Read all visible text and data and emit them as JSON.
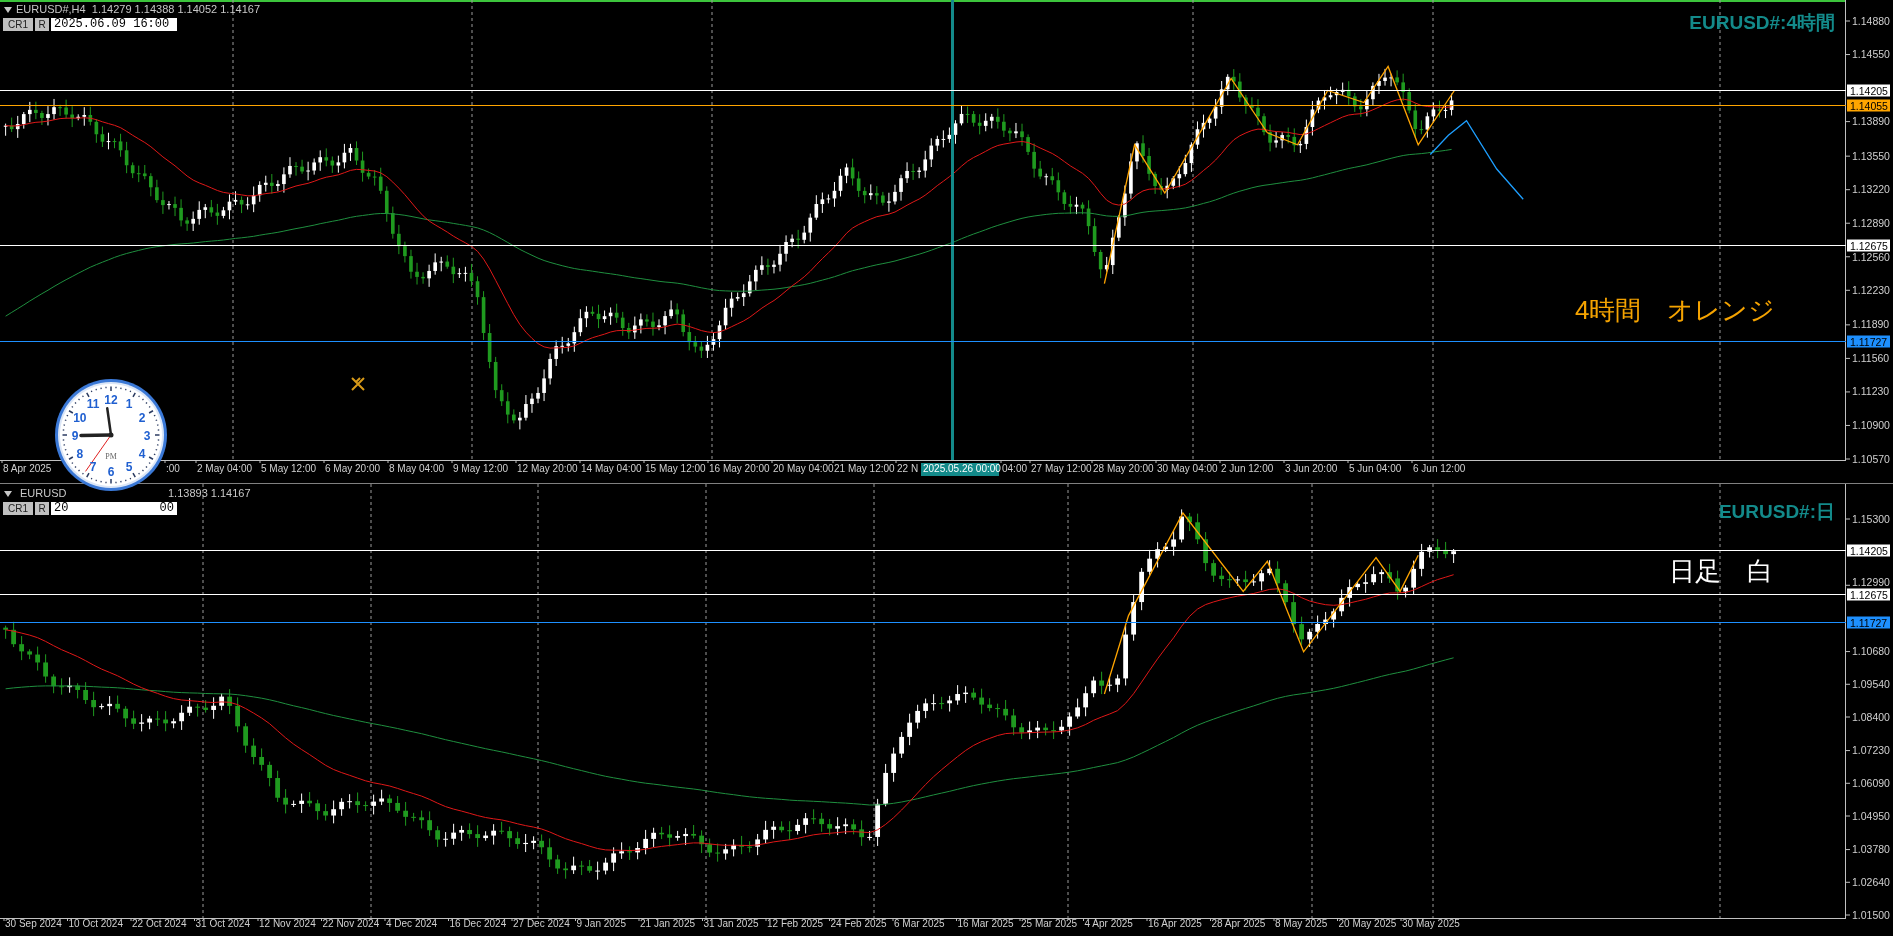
{
  "panels": [
    {
      "header": {
        "info": [
          "EURUSD#,H4  1.14279 1.14388 1.14052 1.14167"
        ],
        "buttons": [
          "CR1",
          "R"
        ],
        "date_field": [
          "2025.06.09 16:00"
        ]
      },
      "title": "EURUSD#:4時間",
      "note": {
        "text": "4時間　オレンジ",
        "color": "#f5a300"
      },
      "price_ticks": [
        "1.14880",
        "1.14550",
        "1.13890",
        "1.13550",
        "1.13220",
        "1.12890",
        "1.12560",
        "1.12230",
        "1.11890",
        "1.11560",
        "1.11230",
        "1.10900",
        "1.10570"
      ],
      "levels": [
        {
          "price": "1.14205",
          "color": "#ffffff"
        },
        {
          "price": "1.14055",
          "color": "#ffa500"
        },
        {
          "price": "1.12675",
          "color": "#ffffff"
        },
        {
          "price": "1.11727",
          "color": "#1e90ff"
        }
      ],
      "time_labels": [
        {
          "text": "8 Apr 2025",
          "kind": "label"
        },
        {
          "text": ":00",
          "kind": "label"
        },
        {
          "text": "2 May 04:00",
          "kind": "label"
        },
        {
          "text": "5 May 12:00",
          "kind": "label"
        },
        {
          "text": "6 May 20:00",
          "kind": "label"
        },
        {
          "text": "8 May 04:00",
          "kind": "label"
        },
        {
          "text": "9 May 12:00",
          "kind": "label"
        },
        {
          "text": "12 May 20:00",
          "kind": "label"
        },
        {
          "text": "14 May 04:00",
          "kind": "label"
        },
        {
          "text": "15 May 12:00",
          "kind": "label"
        },
        {
          "text": "16 May 20:00",
          "kind": "label"
        },
        {
          "text": "20 May 04:00",
          "kind": "label"
        },
        {
          "text": "21 May 12:00",
          "kind": "label"
        },
        {
          "text": "22 N",
          "kind": "label"
        },
        {
          "text": "2025.05.26 00:00",
          "kind": "cursor"
        },
        {
          "text": "04:00",
          "kind": "label"
        },
        {
          "text": "27 May 12:00",
          "kind": "label"
        },
        {
          "text": "28 May 20:00",
          "kind": "label"
        },
        {
          "text": "30 May 04:00",
          "kind": "label"
        },
        {
          "text": "2 Jun 12:00",
          "kind": "label"
        },
        {
          "text": "3 Jun 20:00",
          "kind": "label"
        },
        {
          "text": "5 Jun 04:00",
          "kind": "label"
        },
        {
          "text": "6 Jun 12:00",
          "kind": "label"
        }
      ]
    },
    {
      "header": {
        "info": [
          "EURUSD",
          "1.13893 1.14167"
        ],
        "buttons": [
          "CR1",
          "R"
        ],
        "date_field": [
          "20",
          "00"
        ]
      },
      "title": "EURUSD#:日",
      "note": {
        "text": "日足　白",
        "color": "#ffffff"
      },
      "price_ticks": [
        "1.15300",
        "1.12990",
        "1.10680",
        "1.09540",
        "1.08400",
        "1.07230",
        "1.06090",
        "1.04950",
        "1.03780",
        "1.02640",
        "1.01500"
      ],
      "levels": [
        {
          "price": "1.14205",
          "color": "#ffffff"
        },
        {
          "price": "1.12675",
          "color": "#ffffff"
        },
        {
          "price": "1.11727",
          "color": "#1e90ff"
        }
      ],
      "time_labels": [
        {
          "text": "30 Sep 2024",
          "kind": "label"
        },
        {
          "text": "10 Oct 2024",
          "kind": "label"
        },
        {
          "text": "22 Oct 2024",
          "kind": "label"
        },
        {
          "text": "31 Oct 2024",
          "kind": "label"
        },
        {
          "text": "12 Nov 2024",
          "kind": "label"
        },
        {
          "text": "22 Nov 2024",
          "kind": "label"
        },
        {
          "text": "4 Dec 2024",
          "kind": "label"
        },
        {
          "text": "16 Dec 2024",
          "kind": "label"
        },
        {
          "text": "27 Dec 2024",
          "kind": "label"
        },
        {
          "text": "9 Jan 2025",
          "kind": "label"
        },
        {
          "text": "21 Jan 2025",
          "kind": "label"
        },
        {
          "text": "31 Jan 2025",
          "kind": "label"
        },
        {
          "text": "12 Feb 2025",
          "kind": "label"
        },
        {
          "text": "24 Feb 2025",
          "kind": "label"
        },
        {
          "text": "6 Mar 2025",
          "kind": "label"
        },
        {
          "text": "16 Mar 2025",
          "kind": "label"
        },
        {
          "text": "25 Mar 2025",
          "kind": "label"
        },
        {
          "text": "4 Apr 2025",
          "kind": "label"
        },
        {
          "text": "16 Apr 2025",
          "kind": "label"
        },
        {
          "text": "28 Apr 2025",
          "kind": "label"
        },
        {
          "text": "8 May 2025",
          "kind": "label"
        },
        {
          "text": "20 May 2025",
          "kind": "label"
        },
        {
          "text": "30 May 2025",
          "kind": "label"
        }
      ]
    }
  ],
  "clock": {
    "numerals": [
      "12",
      "11",
      "1",
      "10",
      "2",
      "9",
      "3",
      "8",
      "4",
      "7",
      "5",
      "6"
    ],
    "meridiem": "PM"
  }
}
